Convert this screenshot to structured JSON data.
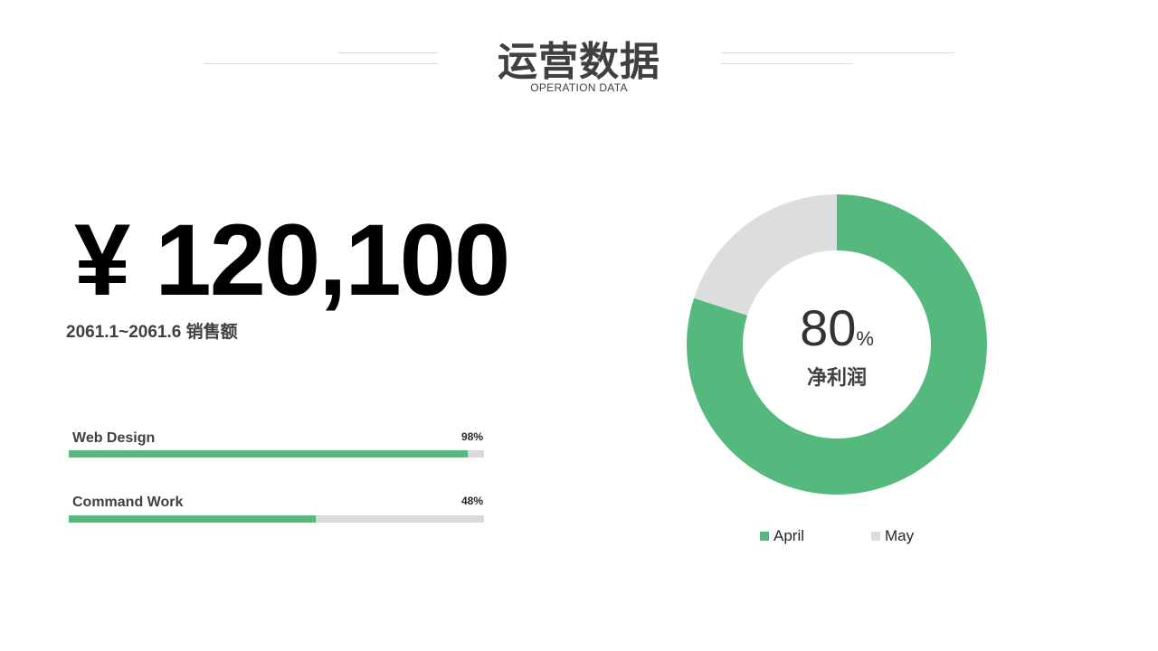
{
  "header": {
    "title": "运营数据",
    "subtitle": "OPERATION DATA"
  },
  "sales": {
    "amount": "¥ 120,100",
    "caption": "2061.1~2061.6 销售额"
  },
  "skills": [
    {
      "label": "Web Design",
      "percent_text": "98%",
      "value": 0.96
    },
    {
      "label": "Command Work",
      "percent_text": "48%",
      "value": 0.595
    }
  ],
  "colors": {
    "accent": "#55b87c",
    "muted": "#dcdddf",
    "track": "#d9d9d9",
    "text": "#404040"
  },
  "chart_data": {
    "type": "pie",
    "variant": "donut",
    "categories": [
      "April",
      "May"
    ],
    "values": [
      80,
      20
    ],
    "center_value": "80",
    "center_unit": "%",
    "center_label": "净利润",
    "legend": [
      {
        "name": "April",
        "color": "#55b87c"
      },
      {
        "name": "May",
        "color": "#dcdddf"
      }
    ],
    "legend_position": "bottom"
  }
}
